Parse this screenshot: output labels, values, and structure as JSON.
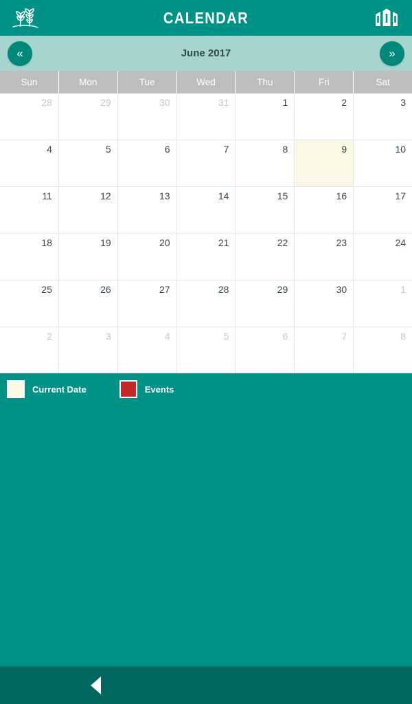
{
  "appbar": {
    "title": "CALENDAR",
    "left_icon": "plant-seedlings-icon",
    "right_icon": "building-icon",
    "background": "#009287"
  },
  "month_nav": {
    "prev_label": "«",
    "next_label": "»",
    "month_label": "June 2017",
    "background": "#a6d5cd"
  },
  "calendar": {
    "day_headers": [
      "Sun",
      "Mon",
      "Tue",
      "Wed",
      "Thu",
      "Fri",
      "Sat"
    ],
    "header_background": "#bdbdbd",
    "today_background": "#fbf8e6",
    "weeks": [
      [
        {
          "d": "28",
          "other": true
        },
        {
          "d": "29",
          "other": true
        },
        {
          "d": "30",
          "other": true
        },
        {
          "d": "31",
          "other": true
        },
        {
          "d": "1",
          "other": false
        },
        {
          "d": "2",
          "other": false
        },
        {
          "d": "3",
          "other": false
        }
      ],
      [
        {
          "d": "4",
          "other": false
        },
        {
          "d": "5",
          "other": false
        },
        {
          "d": "6",
          "other": false
        },
        {
          "d": "7",
          "other": false
        },
        {
          "d": "8",
          "other": false
        },
        {
          "d": "9",
          "other": false,
          "today": true
        },
        {
          "d": "10",
          "other": false
        }
      ],
      [
        {
          "d": "11",
          "other": false
        },
        {
          "d": "12",
          "other": false
        },
        {
          "d": "13",
          "other": false
        },
        {
          "d": "14",
          "other": false
        },
        {
          "d": "15",
          "other": false
        },
        {
          "d": "16",
          "other": false
        },
        {
          "d": "17",
          "other": false
        }
      ],
      [
        {
          "d": "18",
          "other": false
        },
        {
          "d": "19",
          "other": false
        },
        {
          "d": "20",
          "other": false
        },
        {
          "d": "21",
          "other": false
        },
        {
          "d": "22",
          "other": false
        },
        {
          "d": "23",
          "other": false
        },
        {
          "d": "24",
          "other": false
        }
      ],
      [
        {
          "d": "25",
          "other": false
        },
        {
          "d": "26",
          "other": false
        },
        {
          "d": "27",
          "other": false
        },
        {
          "d": "28",
          "other": false
        },
        {
          "d": "29",
          "other": false
        },
        {
          "d": "30",
          "other": false
        },
        {
          "d": "1",
          "other": true
        }
      ],
      [
        {
          "d": "2",
          "other": true
        },
        {
          "d": "3",
          "other": true
        },
        {
          "d": "4",
          "other": true
        },
        {
          "d": "5",
          "other": true
        },
        {
          "d": "6",
          "other": true
        },
        {
          "d": "7",
          "other": true
        },
        {
          "d": "8",
          "other": true
        }
      ]
    ]
  },
  "legend": {
    "items": [
      {
        "label": "Current Date",
        "color": "#fbf8e6"
      },
      {
        "label": "Events",
        "color": "#c62828"
      }
    ]
  },
  "bottom_nav": {
    "back_icon": "back-triangle-icon",
    "background": "#00685f"
  }
}
